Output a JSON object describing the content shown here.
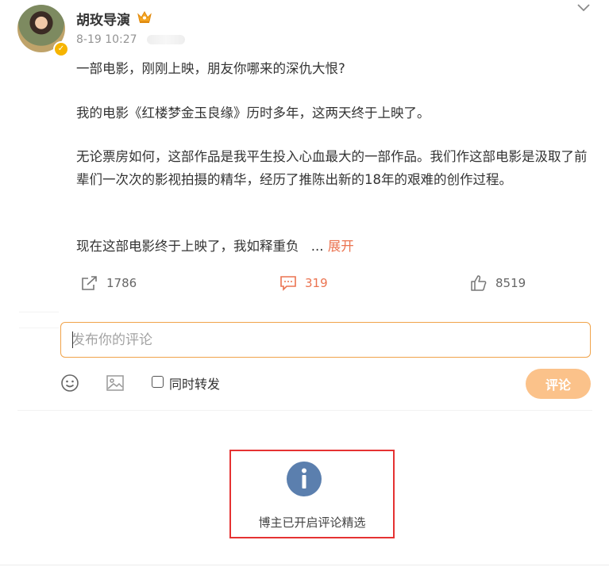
{
  "post": {
    "author": "胡玫导演",
    "timestamp": "8-19 10:27",
    "paragraphs": [
      "一部电影，刚刚上映，朋友你哪来的深仇大恨?",
      "我的电影《红楼梦金玉良缘》历时多年，这两天终于上映了。",
      "无论票房如何，这部作品是我平生投入心血最大的一部作品。我们作这部电影是汲取了前辈们一次次的影视拍摄的精华，经历了推陈出新的18年的艰难的创作过程。",
      "现在这部电影终于上映了，我如释重负"
    ],
    "ellipsis": "...",
    "expand_label": "展开"
  },
  "actions": {
    "reposts": "1786",
    "comments": "319",
    "likes": "8519"
  },
  "composer": {
    "placeholder": "发布你的评论",
    "repost_label": "同时转发",
    "submit_label": "评论"
  },
  "notice": {
    "text": "博主已开启评论精选"
  },
  "colors": {
    "accent": "#eb7350",
    "input_border": "#f0a34a",
    "submit_bg": "#fbc28a",
    "notice_icon": "#5b7fae",
    "highlight_frame": "#e53232"
  },
  "icons": [
    "chevron-down-icon",
    "verified-badge-icon",
    "crown-icon",
    "repost-icon",
    "comment-icon",
    "like-icon",
    "emoji-icon",
    "image-icon",
    "info-icon"
  ]
}
